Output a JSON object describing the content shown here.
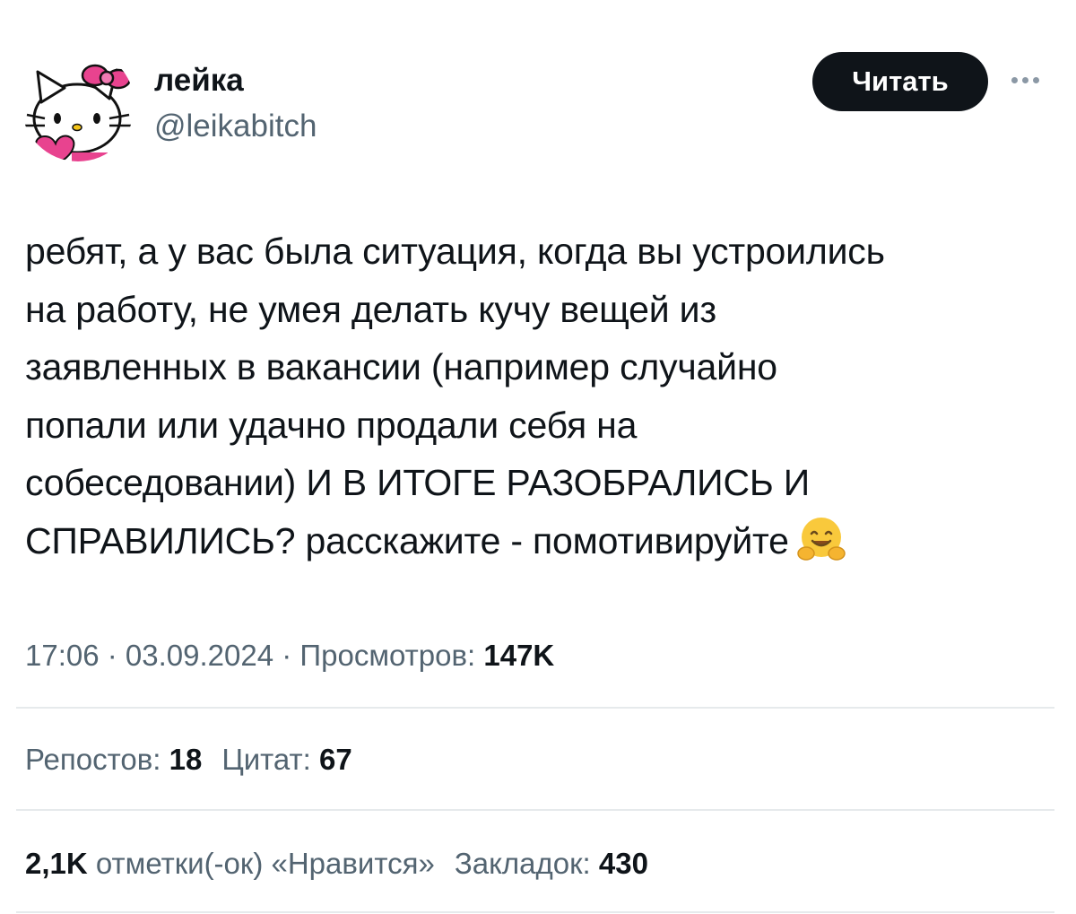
{
  "author": {
    "display_name": "лейка",
    "handle": "@leikabitch"
  },
  "follow_button": {
    "label": "Читать"
  },
  "more_button": {
    "icon": "more-horizontal-icon"
  },
  "tweet": {
    "lines": [
      "ребят, а у вас была ситуация, когда вы устроились",
      "на работу, не умея делать кучу вещей из",
      "заявленных в вакансии (например случайно",
      "попали или удачно продали себя на",
      "собеседовании) И В ИТОГЕ РАЗОБРАЛИСЬ И",
      "СПРАВИЛИСЬ? расскажите - помотивируйте"
    ],
    "emoji": "hugging-face-emoji"
  },
  "meta": {
    "time": "17:06",
    "separator": " · ",
    "date": "03.09.2024",
    "views_label": "Просмотров:",
    "views_value": "147K"
  },
  "stats": {
    "reposts_label": "Репостов:",
    "reposts_value": "18",
    "quotes_label": "Цитат:",
    "quotes_value": "67",
    "likes_value": "2,1K",
    "likes_label": "отметки(-ок) «Нравится»",
    "bookmarks_label": "Закладок:",
    "bookmarks_value": "430"
  },
  "colors": {
    "text": "#0f1419",
    "secondary": "#536471",
    "divider": "#e6eaec",
    "button_bg": "#0f1419",
    "button_text": "#ffffff"
  }
}
